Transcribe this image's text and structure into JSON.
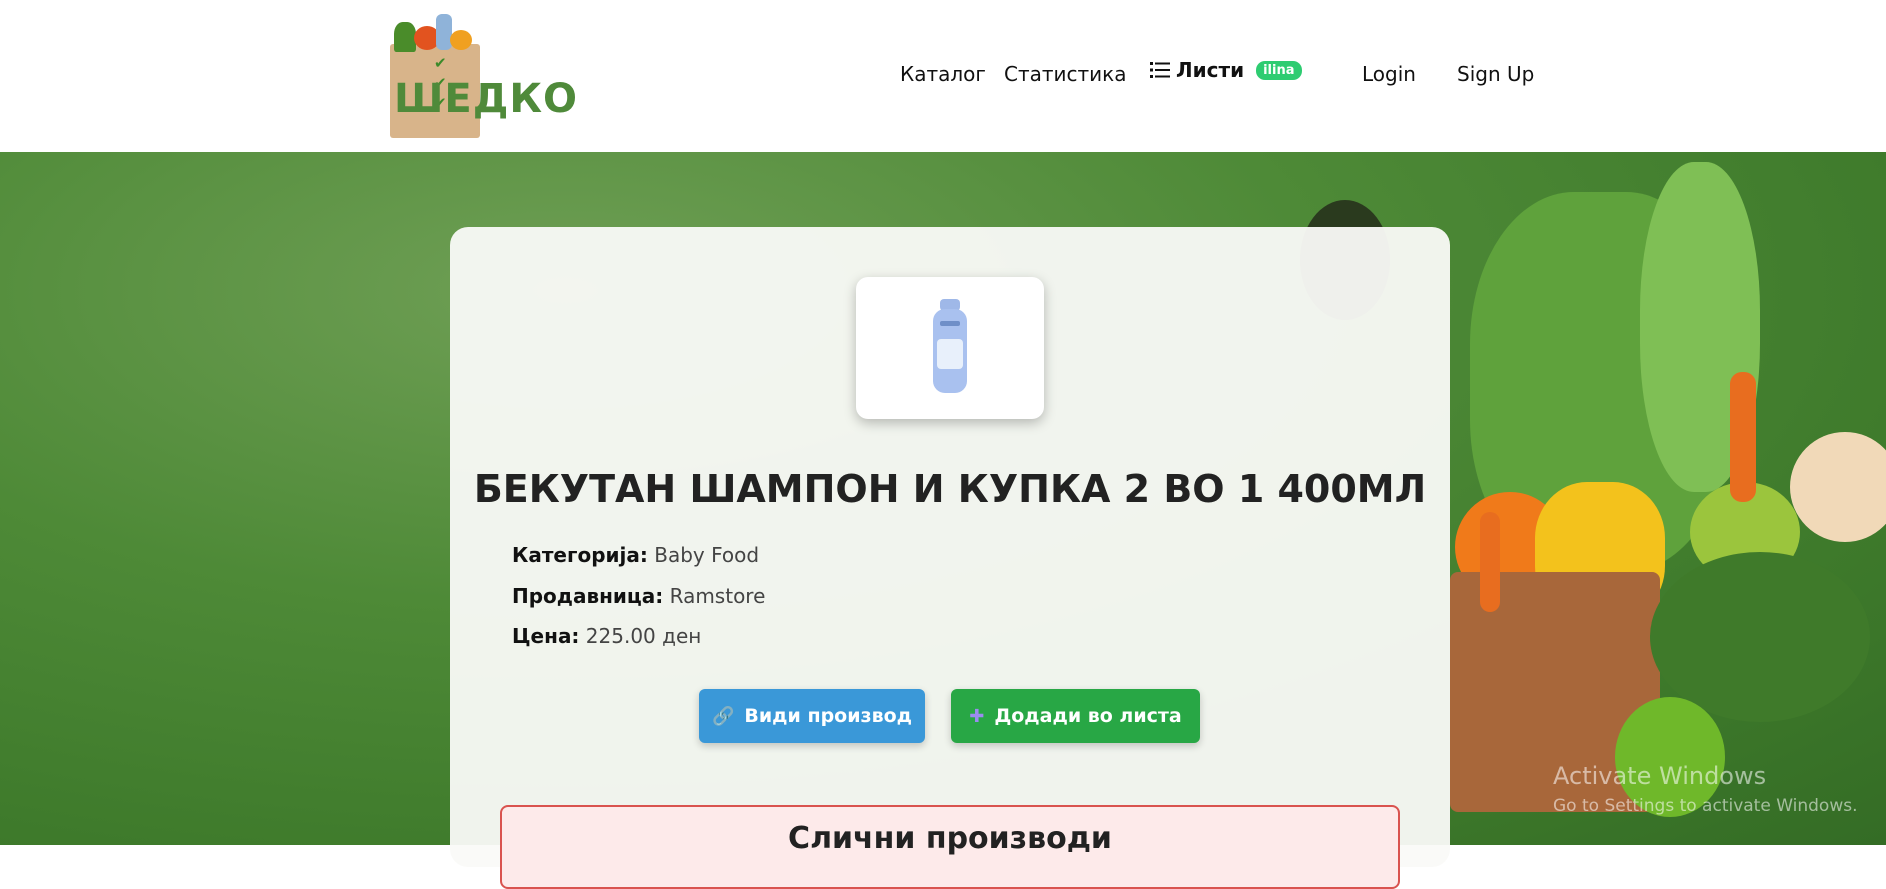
{
  "header": {
    "logo_text": "ШЕДКО",
    "nav": {
      "catalog": "Каталог",
      "statistics": "Статистика",
      "lists": "Листи",
      "user_badge": "ilina",
      "login": "Login",
      "signup": "Sign Up"
    }
  },
  "product": {
    "title": "БЕКУТАН ШАМПОН И КУПКА 2 ВО 1 400МЛ",
    "category_label": "Категорија:",
    "category_value": "Baby Food",
    "store_label": "Продавница:",
    "store_value": "Ramstore",
    "price_label": "Цена:",
    "price_value": "225.00 ден",
    "view_button": "Види производ",
    "add_button": "Додади во листа"
  },
  "similar": {
    "title": "Слични производи"
  },
  "watermark": {
    "line1": "Activate Windows",
    "line2": "Go to Settings to activate Windows."
  },
  "colors": {
    "badge": "#2ecc71",
    "view_button": "#3a98d8",
    "add_button": "#28a745",
    "similar_border": "#d9534f"
  }
}
